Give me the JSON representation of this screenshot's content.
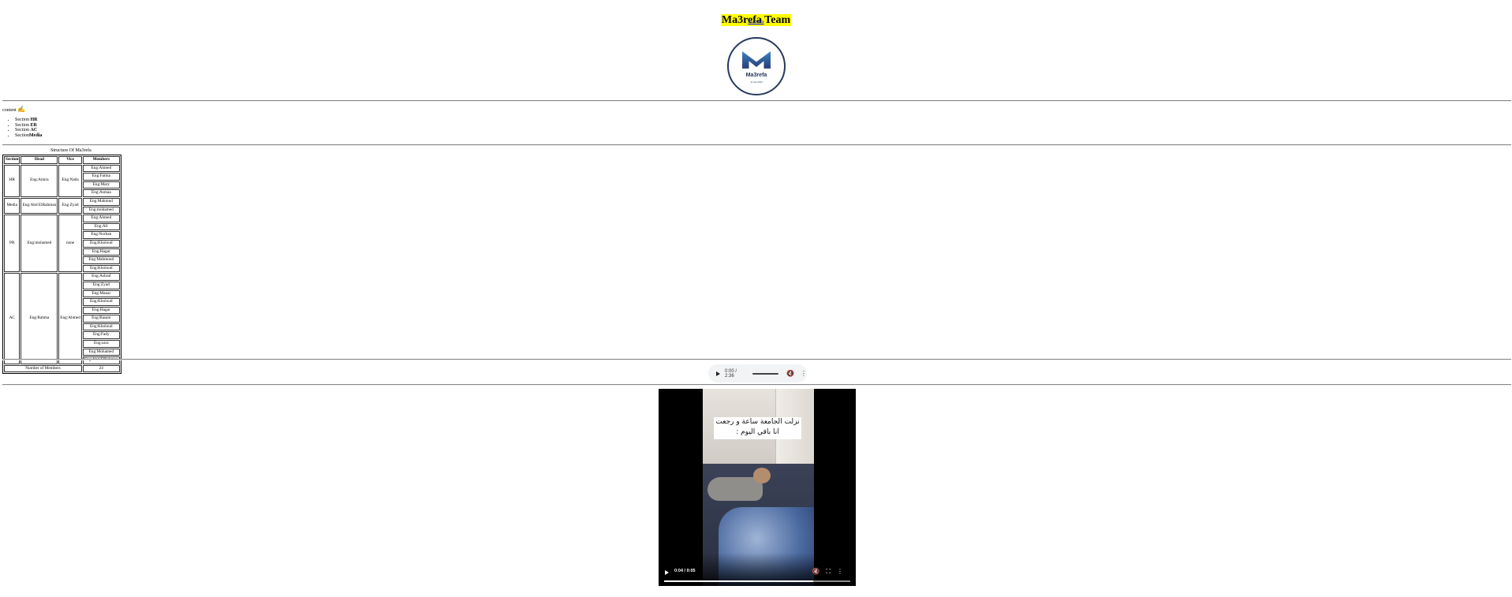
{
  "header": {
    "title": "Ma3refa Team",
    "link_text": "Ma3refa"
  },
  "logo": {
    "name": "Ma3refa",
    "sub": "11 Jan 2023"
  },
  "content": {
    "label": "content",
    "mark": "✍",
    "section_prefix": "Section",
    "sections": [
      "HR",
      "ER",
      "AC",
      "Media"
    ]
  },
  "structure": {
    "caption": "Structure Of Ma3refa",
    "headers": [
      "Section",
      "Head",
      "Vice",
      "Members"
    ],
    "groups": [
      {
        "section": "HR",
        "head": "Eng:Amira",
        "vice": "Eng:Nada",
        "members": [
          "Eng:Ahmed",
          "Eng:Fatma",
          "Eng:Mary",
          "Eng:Asmaa"
        ]
      },
      {
        "section": "Media",
        "head": "Eng:Abd ElRahman",
        "vice": "Eng:Zyad",
        "members": [
          "Eng:Mahmud",
          "Eng:mohamed"
        ]
      },
      {
        "section": "PR",
        "head": "Eng:mohamed",
        "vice": "none",
        "members": [
          "Eng:Ahmed",
          "Eng:Ali",
          "Eng:Norhan",
          "Eng:Kholoud",
          "Eng:Hagar",
          "Eng:Mahmoud",
          "Eng:Kholoud"
        ]
      },
      {
        "section": "AC",
        "head": "Eng:Rahma",
        "vice": "Eng:Ahmed",
        "members": [
          "Eng:Ashraf",
          "Eng:Zyad",
          "Eng:Manar",
          "Eng:Kholoud",
          "Eng:Hagar",
          "Eng:Basant",
          "Eng:Kholoud",
          "Eng:Fady",
          "Eng:sara",
          "Eng:Mohamed",
          "Eng:Abd ElRahman"
        ]
      }
    ],
    "footer_label": "Number of Members",
    "footer_value": "24"
  },
  "audio": {
    "time": "0:00 / 2:36",
    "mute_icon": "volume-muted-icon",
    "more_icon": "more-vertical-icon"
  },
  "video": {
    "caption_line1": "نزلت الجامعة ساعة و رجعت",
    "caption_line2": "انا باقي اليوم :",
    "time": "0:04 / 0:05",
    "progress": 0.8
  }
}
